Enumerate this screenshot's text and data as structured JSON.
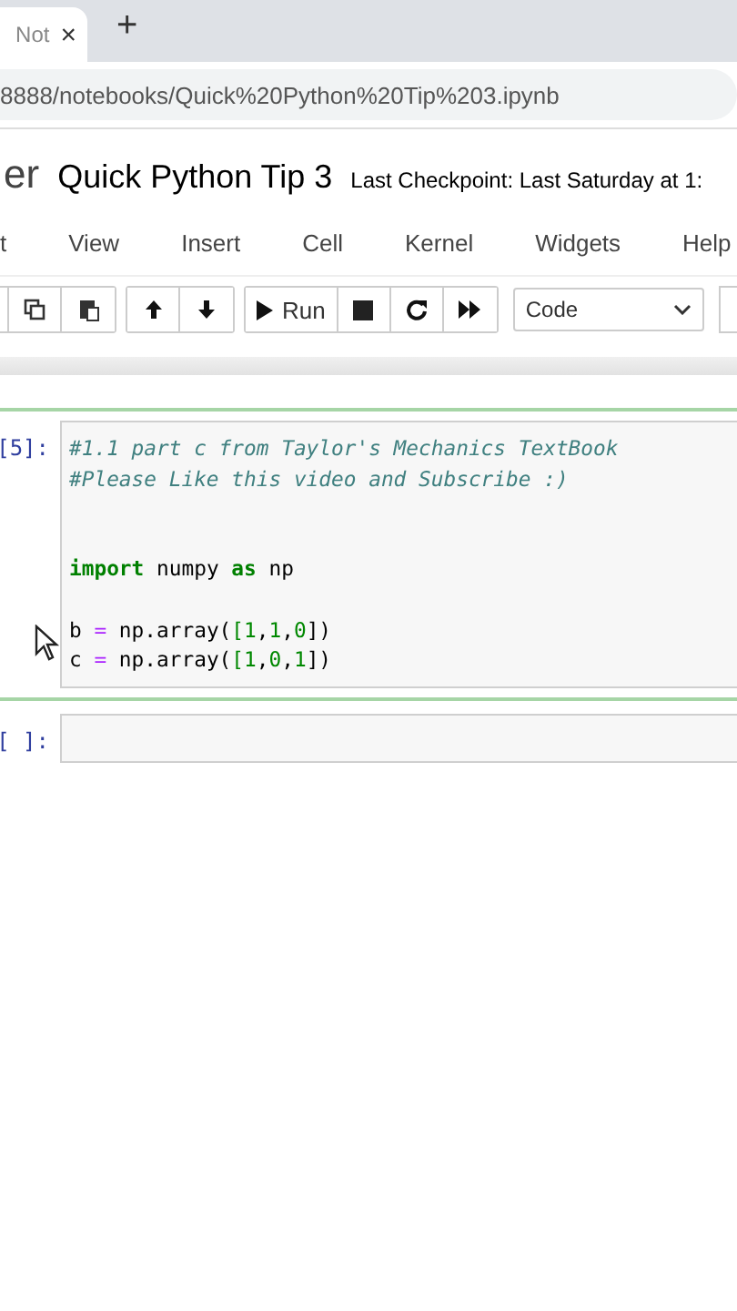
{
  "browser": {
    "tab": {
      "title": "Not",
      "close": "×"
    },
    "new_tab": "+",
    "url": "8888/notebooks/Quick%20Python%20Tip%203.ipynb"
  },
  "header": {
    "logo": "er",
    "notebook_title": "Quick Python Tip 3",
    "checkpoint": "Last Checkpoint: Last Saturday at 1:"
  },
  "menu": [
    "t",
    "View",
    "Insert",
    "Cell",
    "Kernel",
    "Widgets",
    "Help"
  ],
  "toolbar": {
    "run_label": "Run",
    "cell_type": "Code"
  },
  "cells": [
    {
      "prompt": "[5]:",
      "selected": true,
      "lines": [
        [
          {
            "text": "#1.1 part c from Taylor's Mechanics TextBook",
            "kind": "comment"
          }
        ],
        [
          {
            "text": "#Please Like this video and Subscribe :)",
            "kind": "comment"
          }
        ],
        {
          "kind": "blank"
        },
        {
          "kind": "blank"
        },
        [
          {
            "text": "import",
            "kind": "keyword"
          },
          {
            "text": " numpy ",
            "kind": "plain"
          },
          {
            "text": "as",
            "kind": "keyword"
          },
          {
            "text": " np",
            "kind": "plain"
          }
        ],
        {
          "kind": "blank"
        },
        [
          {
            "text": "b ",
            "kind": "plain"
          },
          {
            "text": "=",
            "kind": "operator"
          },
          {
            "text": " np.array(",
            "kind": "plain"
          },
          {
            "text": "[",
            "kind": "bracket"
          },
          {
            "text": "1",
            "kind": "number"
          },
          {
            "text": ",",
            "kind": "plain"
          },
          {
            "text": "1",
            "kind": "number"
          },
          {
            "text": ",",
            "kind": "plain"
          },
          {
            "text": "0",
            "kind": "number"
          },
          {
            "text": "])",
            "kind": "plain"
          }
        ],
        [
          {
            "text": "c ",
            "kind": "plain"
          },
          {
            "text": "=",
            "kind": "operator"
          },
          {
            "text": " np.array(",
            "kind": "plain"
          },
          {
            "text": "[",
            "kind": "bracket"
          },
          {
            "text": "1",
            "kind": "number"
          },
          {
            "text": ",",
            "kind": "plain"
          },
          {
            "text": "0",
            "kind": "number"
          },
          {
            "text": ",",
            "kind": "plain"
          },
          {
            "text": "1",
            "kind": "number"
          },
          {
            "text": "])",
            "kind": "plain"
          }
        ]
      ]
    },
    {
      "prompt": "[ ]:",
      "selected": false
    }
  ]
}
